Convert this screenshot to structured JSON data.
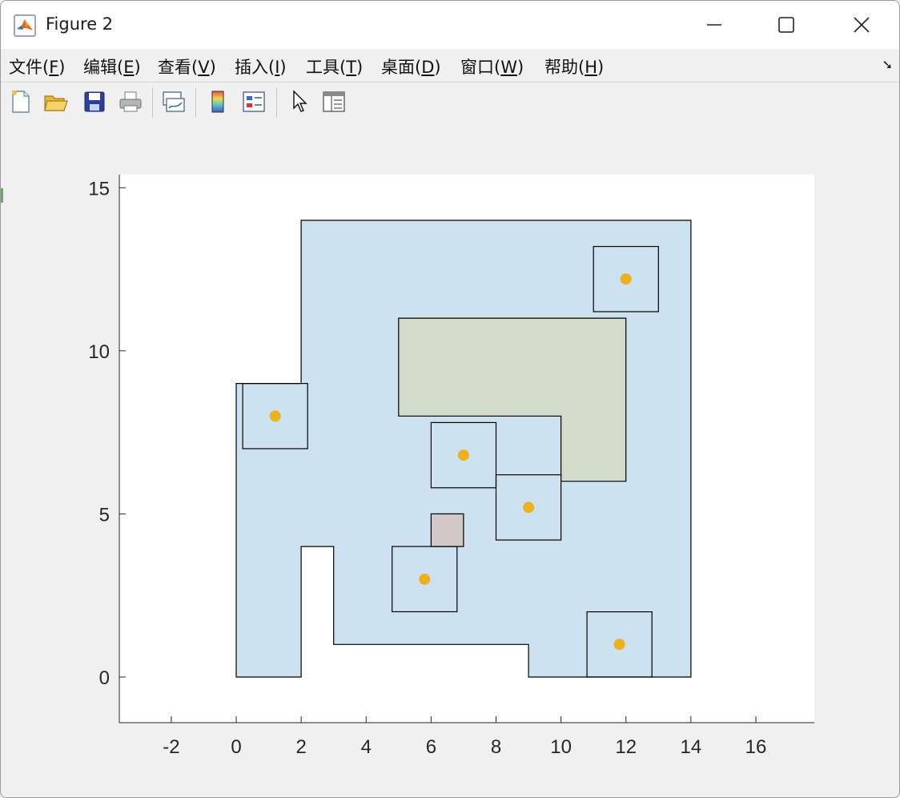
{
  "window": {
    "title": "Figure 2"
  },
  "menu": [
    {
      "label_pre": "文件(",
      "key": "F",
      "label_post": ")"
    },
    {
      "label_pre": "编辑(",
      "key": "E",
      "label_post": ")"
    },
    {
      "label_pre": "查看(",
      "key": "V",
      "label_post": ")"
    },
    {
      "label_pre": "插入(",
      "key": "I",
      "label_post": ")"
    },
    {
      "label_pre": "工具(",
      "key": "T",
      "label_post": ")"
    },
    {
      "label_pre": "桌面(",
      "key": "D",
      "label_post": ")"
    },
    {
      "label_pre": "窗口(",
      "key": "W",
      "label_post": ")"
    },
    {
      "label_pre": "帮助(",
      "key": "H",
      "label_post": ")"
    }
  ],
  "toolbar": [
    "new-figure-icon",
    "open-file-icon",
    "save-icon",
    "print-icon",
    "link-plot-icon",
    "colorbar-icon",
    "legend-icon",
    "edit-pointer-icon",
    "property-inspector-icon"
  ],
  "chart_data": {
    "type": "polygon-plot",
    "title": "",
    "xlabel": "",
    "ylabel": "",
    "xlim": [
      -3.6,
      17.8
    ],
    "ylim": [
      -1.4,
      15.4
    ],
    "xticks": [
      -2,
      0,
      2,
      4,
      6,
      8,
      10,
      12,
      14,
      16
    ],
    "yticks": [
      0,
      5,
      10,
      15
    ],
    "grid": false,
    "colors": {
      "region_fill": "#cde2f1",
      "obstacle_fill": "#d3dbcb",
      "small_obstacle_fill": "#d3c7c9",
      "marker": "#edb120",
      "edge": "#000000"
    },
    "region": [
      [
        0,
        0
      ],
      [
        2,
        0
      ],
      [
        2,
        4
      ],
      [
        3,
        4
      ],
      [
        3,
        1
      ],
      [
        9,
        1
      ],
      [
        9,
        0
      ],
      [
        14,
        0
      ],
      [
        14,
        14
      ],
      [
        2,
        14
      ],
      [
        2,
        9
      ],
      [
        0,
        9
      ]
    ],
    "obstacles": [
      [
        [
          5,
          8
        ],
        [
          10,
          8
        ],
        [
          10,
          6
        ],
        [
          12,
          6
        ],
        [
          12,
          11
        ],
        [
          5,
          11
        ]
      ],
      [
        [
          6,
          4
        ],
        [
          7,
          4
        ],
        [
          7,
          5
        ],
        [
          6,
          5
        ]
      ]
    ],
    "squares": [
      {
        "x0": 0.2,
        "y0": 7,
        "x1": 2.2,
        "y1": 9
      },
      {
        "x0": 11,
        "y0": 11.2,
        "x1": 13,
        "y1": 13.2
      },
      {
        "x0": 6,
        "y0": 5.8,
        "x1": 8,
        "y1": 7.8
      },
      {
        "x0": 8,
        "y0": 4.2,
        "x1": 10,
        "y1": 6.2
      },
      {
        "x0": 4.8,
        "y0": 2,
        "x1": 6.8,
        "y1": 4
      },
      {
        "x0": 10.8,
        "y0": 0,
        "x1": 12.8,
        "y1": 2
      }
    ],
    "points": [
      {
        "x": 1.2,
        "y": 8
      },
      {
        "x": 12,
        "y": 12.2
      },
      {
        "x": 7,
        "y": 6.8
      },
      {
        "x": 9,
        "y": 5.2
      },
      {
        "x": 5.8,
        "y": 3
      },
      {
        "x": 11.8,
        "y": 1
      }
    ]
  }
}
